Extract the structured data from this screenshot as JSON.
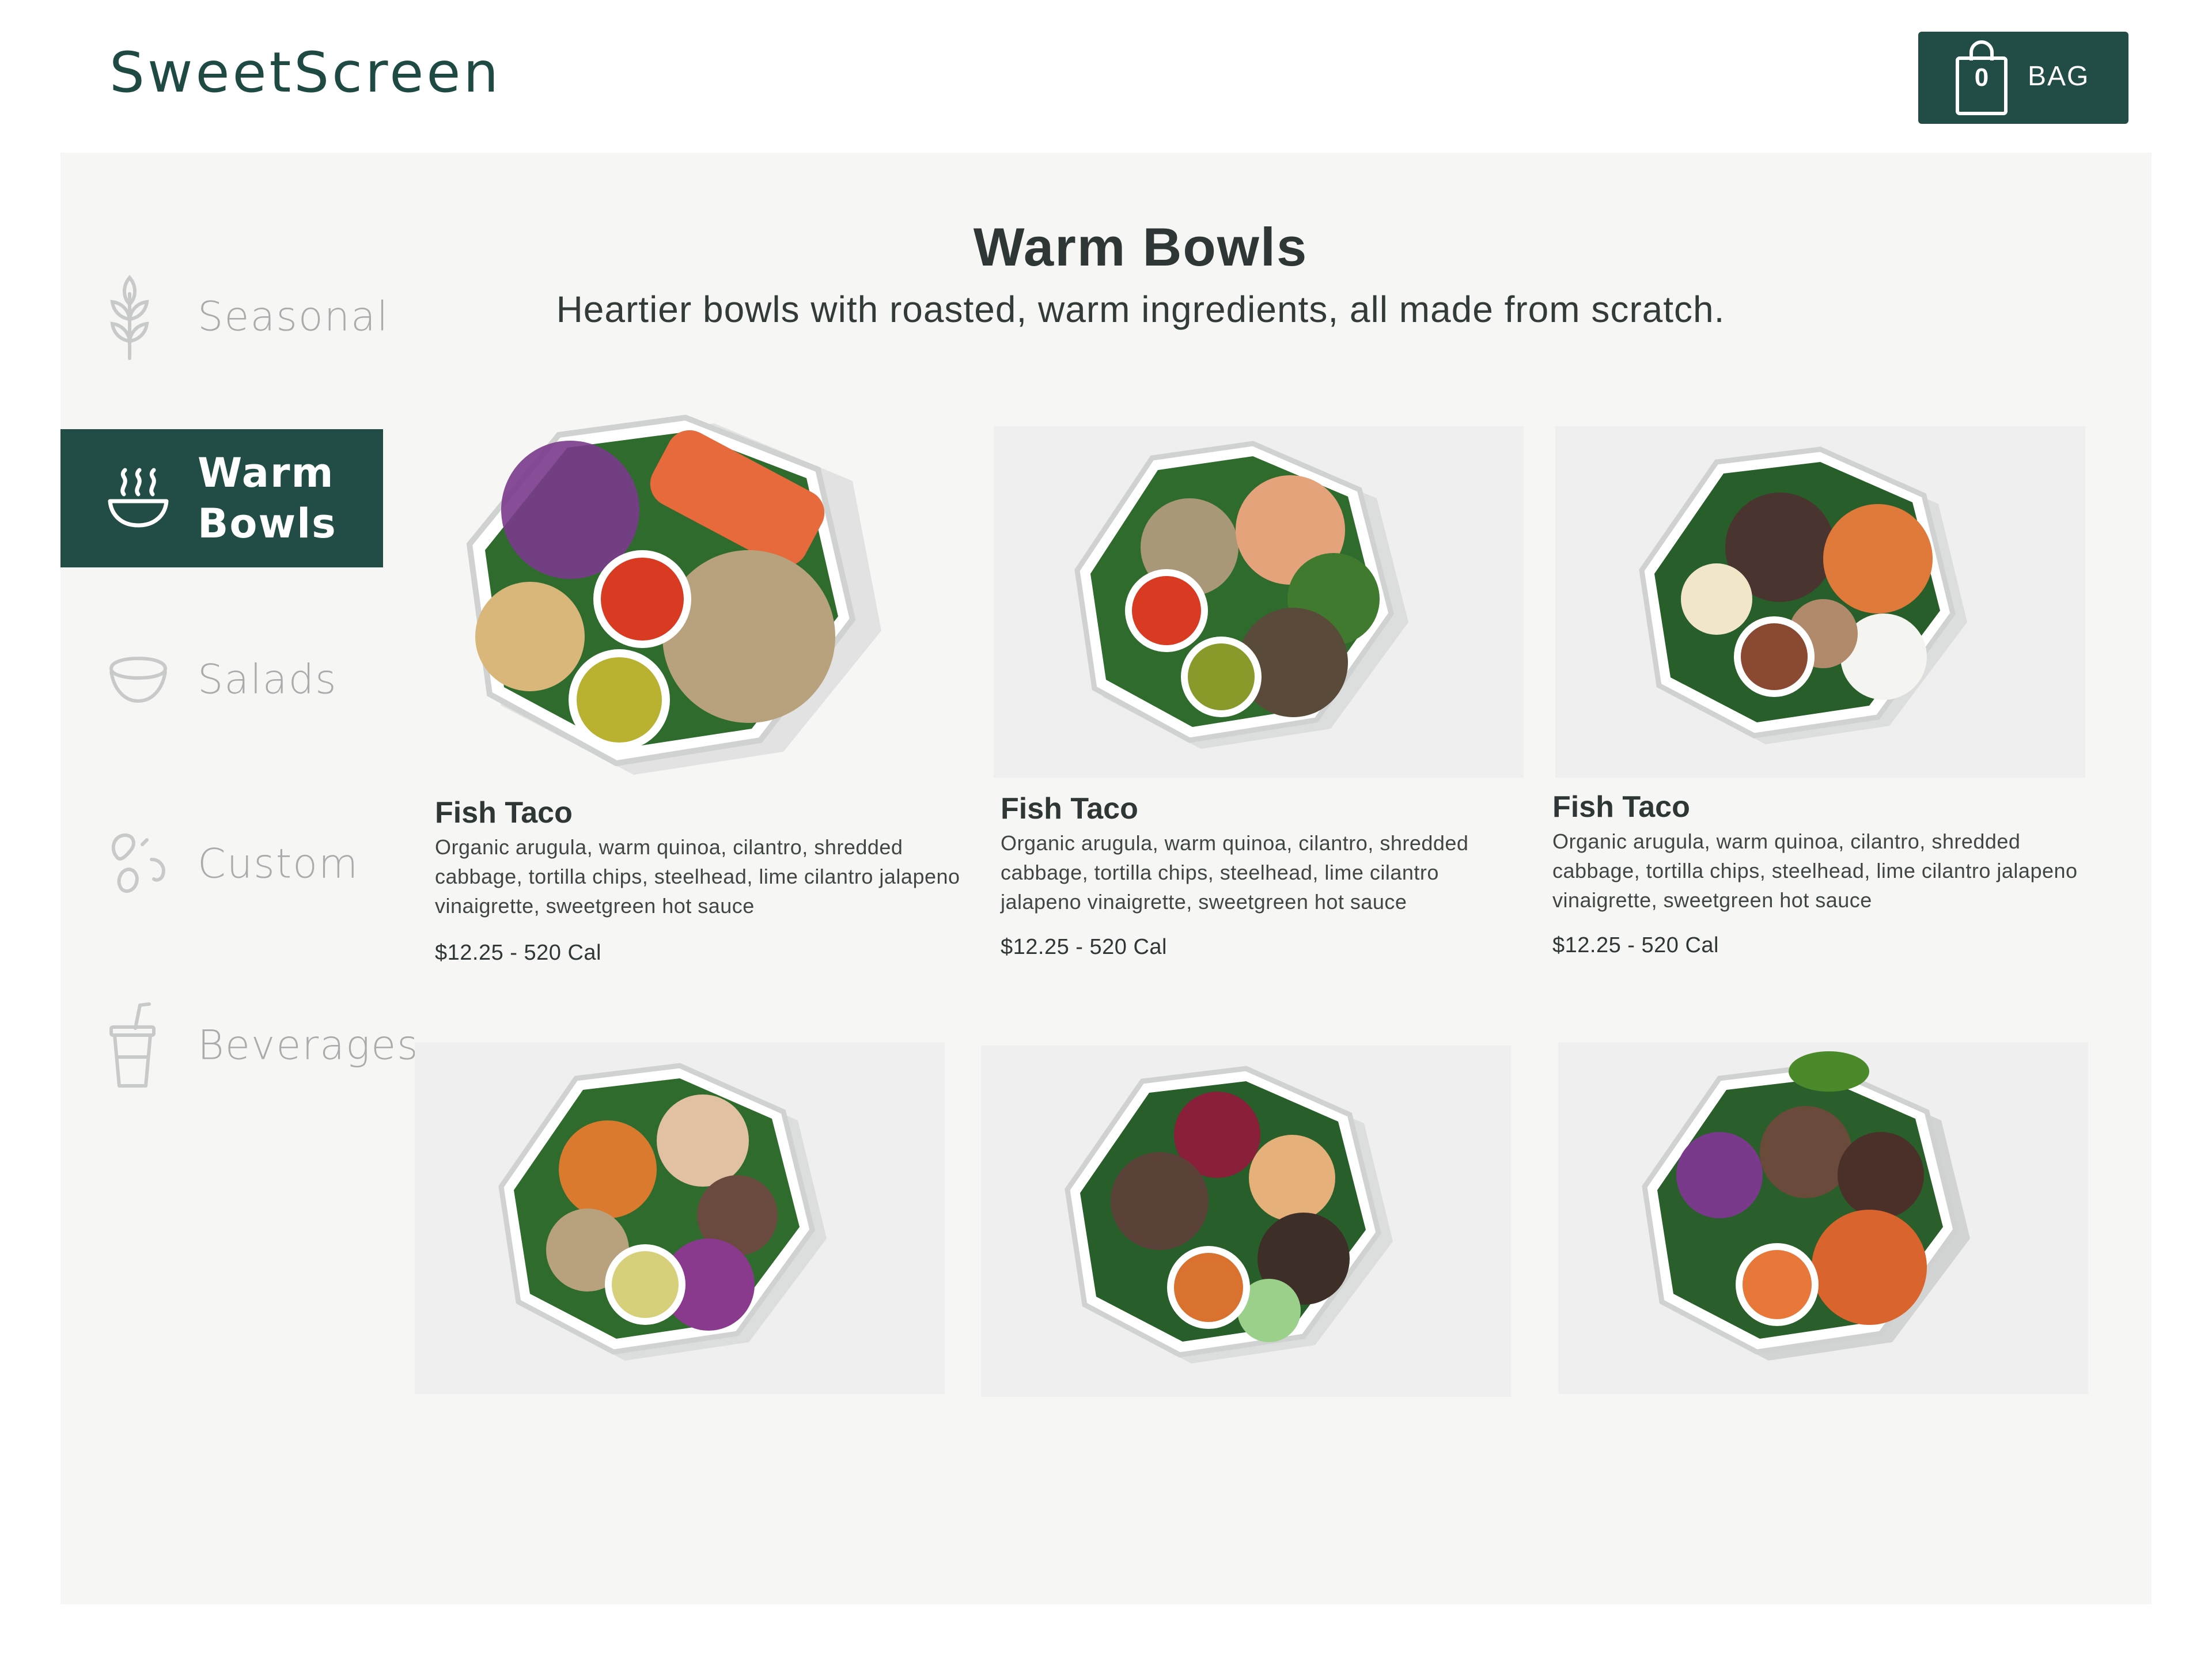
{
  "header": {
    "logo_text": "SweetScreen",
    "bag": {
      "label": "BAG",
      "count": "0"
    }
  },
  "sidebar": {
    "items": [
      {
        "label": "Seasonal",
        "icon": "wheat-icon",
        "active": false
      },
      {
        "label": "Warm Bowls",
        "icon": "steaming-bowl-icon",
        "active": true
      },
      {
        "label": "Salads",
        "icon": "salad-bowl-icon",
        "active": false
      },
      {
        "label": "Custom",
        "icon": "custom-mix-icon",
        "active": false
      },
      {
        "label": "Beverages",
        "icon": "cup-with-straw-icon",
        "active": false
      }
    ]
  },
  "main": {
    "title": "Warm Bowls",
    "subtitle": "Heartier bowls with roasted, warm ingredients, all made from scratch.",
    "products": [
      {
        "name": "Fish Taco",
        "description": "Organic arugula, warm quinoa, cilantro, shredded cabbage, tortilla chips, steelhead, lime cilantro jalapeno vinaigrette, sweetgreen hot sauce",
        "price": "$12.25 - 520 Cal"
      },
      {
        "name": "Fish Taco",
        "description": "Organic arugula, warm quinoa, cilantro, shredded cabbage, tortilla chips, steelhead, lime cilantro jalapeno vinaigrette, sweetgreen hot sauce",
        "price": "$12.25 - 520 Cal"
      },
      {
        "name": "Fish Taco",
        "description": "Organic arugula, warm quinoa, cilantro, shredded cabbage, tortilla chips, steelhead, lime cilantro jalapeno vinaigrette, sweetgreen hot sauce",
        "price": "$12.25 - 520 Cal"
      },
      {
        "name": "",
        "description": "",
        "price": ""
      },
      {
        "name": "",
        "description": "",
        "price": ""
      },
      {
        "name": "",
        "description": "",
        "price": ""
      }
    ]
  },
  "colors": {
    "brand_green": "#224d46",
    "panel_bg": "#f6f6f4",
    "inactive_text": "#a9acab"
  }
}
